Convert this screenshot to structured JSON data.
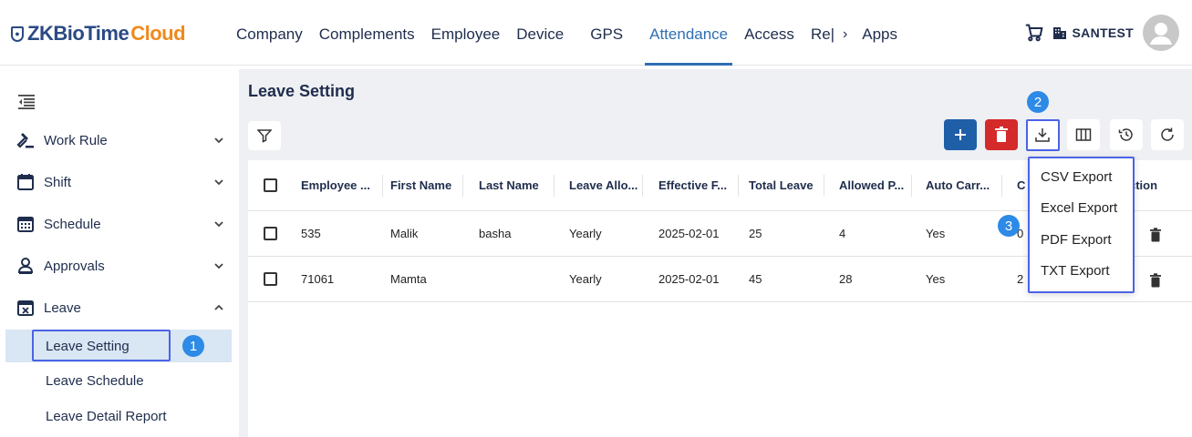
{
  "brand": {
    "name_part1": "ZKBioTime",
    "name_part2": "Cloud",
    "accent": "#2b4a84",
    "accent2": "#f08a1c"
  },
  "nav": {
    "items": [
      {
        "label": "Company"
      },
      {
        "label": "Complements"
      },
      {
        "label": "Employee"
      },
      {
        "label": "Device"
      },
      {
        "label": "GPS"
      },
      {
        "label": "Attendance",
        "active": true
      },
      {
        "label": "Access"
      },
      {
        "label": "Re|"
      },
      {
        "label": "Apps"
      }
    ],
    "more_arrow": "›",
    "company": "SANTEST",
    "icons": [
      "cart-icon",
      "building-icon",
      "avatar-icon"
    ]
  },
  "sidebar": {
    "items": [
      {
        "label": "Work Rule",
        "icon": "gavel-icon",
        "expanded": false
      },
      {
        "label": "Shift",
        "icon": "calendar-icon",
        "expanded": false
      },
      {
        "label": "Schedule",
        "icon": "calendar-grid-icon",
        "expanded": false
      },
      {
        "label": "Approvals",
        "icon": "user-icon",
        "expanded": false
      },
      {
        "label": "Leave",
        "icon": "calendar-x-icon",
        "expanded": true
      }
    ],
    "leave_sub": [
      {
        "label": "Leave Setting",
        "active": true
      },
      {
        "label": "Leave Schedule"
      },
      {
        "label": "Leave Detail Report"
      }
    ]
  },
  "page": {
    "title": "Leave Setting"
  },
  "toolbar": {
    "icons": [
      "filter-icon",
      "add-icon",
      "delete-icon",
      "download-icon",
      "columns-icon",
      "history-icon",
      "refresh-icon"
    ]
  },
  "table": {
    "columns": [
      "Employee ...",
      "First Name",
      "Last Name",
      "Leave Allo...",
      "Effective F...",
      "Total Leave",
      "Allowed P...",
      "Auto Carr...",
      "C",
      "ction"
    ],
    "rows": [
      {
        "employee": "535",
        "first": "Malik",
        "last": "basha",
        "alloc": "Yearly",
        "effective": "2025-02-01",
        "total": "25",
        "allowed": "4",
        "auto": "Yes",
        "c": "0"
      },
      {
        "employee": "71061",
        "first": "Mamta",
        "last": "",
        "alloc": "Yearly",
        "effective": "2025-02-01",
        "total": "45",
        "allowed": "28",
        "auto": "Yes",
        "c": "2"
      }
    ]
  },
  "export_menu": {
    "items": [
      "CSV Export",
      "Excel Export",
      "PDF Export",
      "TXT Export"
    ]
  },
  "callouts": [
    "1",
    "2",
    "3"
  ],
  "colors": {
    "highlight": "#4b63e6",
    "marker": "#2d8ae6",
    "add": "#1f5fa8",
    "delete": "#d42a2a",
    "active_nav": "#2f6fb3"
  }
}
